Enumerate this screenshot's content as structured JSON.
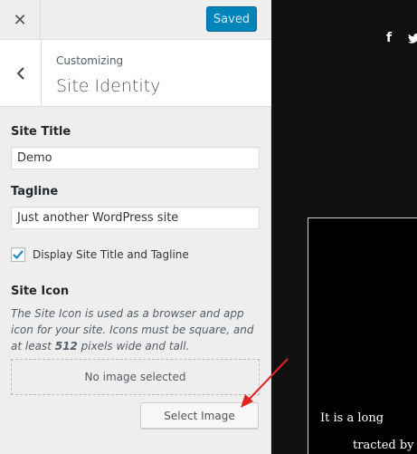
{
  "header": {
    "close_icon": "close-icon",
    "saved_label": "Saved",
    "saved_color": "#0085ba"
  },
  "section": {
    "breadcrumb": "Customizing",
    "title": "Site Identity"
  },
  "form": {
    "site_title_label": "Site Title",
    "site_title_value": "Demo",
    "tagline_label": "Tagline",
    "tagline_value": "Just another WordPress site",
    "display_checkbox_label": "Display Site Title and Tagline",
    "display_checked": true,
    "site_icon_label": "Site Icon",
    "site_icon_desc_pre": "The Site Icon is used as a browser and app icon for your site. Icons must be square, and at least",
    "site_icon_desc_num": "512",
    "site_icon_desc_post": "pixels wide and tall.",
    "no_image_text": "No image selected",
    "select_image_label": "Select Image"
  },
  "preview": {
    "social_icons": [
      "facebook-icon",
      "twitter-icon"
    ],
    "facebook_glyph": "f",
    "text_line1": "It is a long",
    "text_line2": "tracted by"
  },
  "annotation_arrow_color": "#e02424"
}
